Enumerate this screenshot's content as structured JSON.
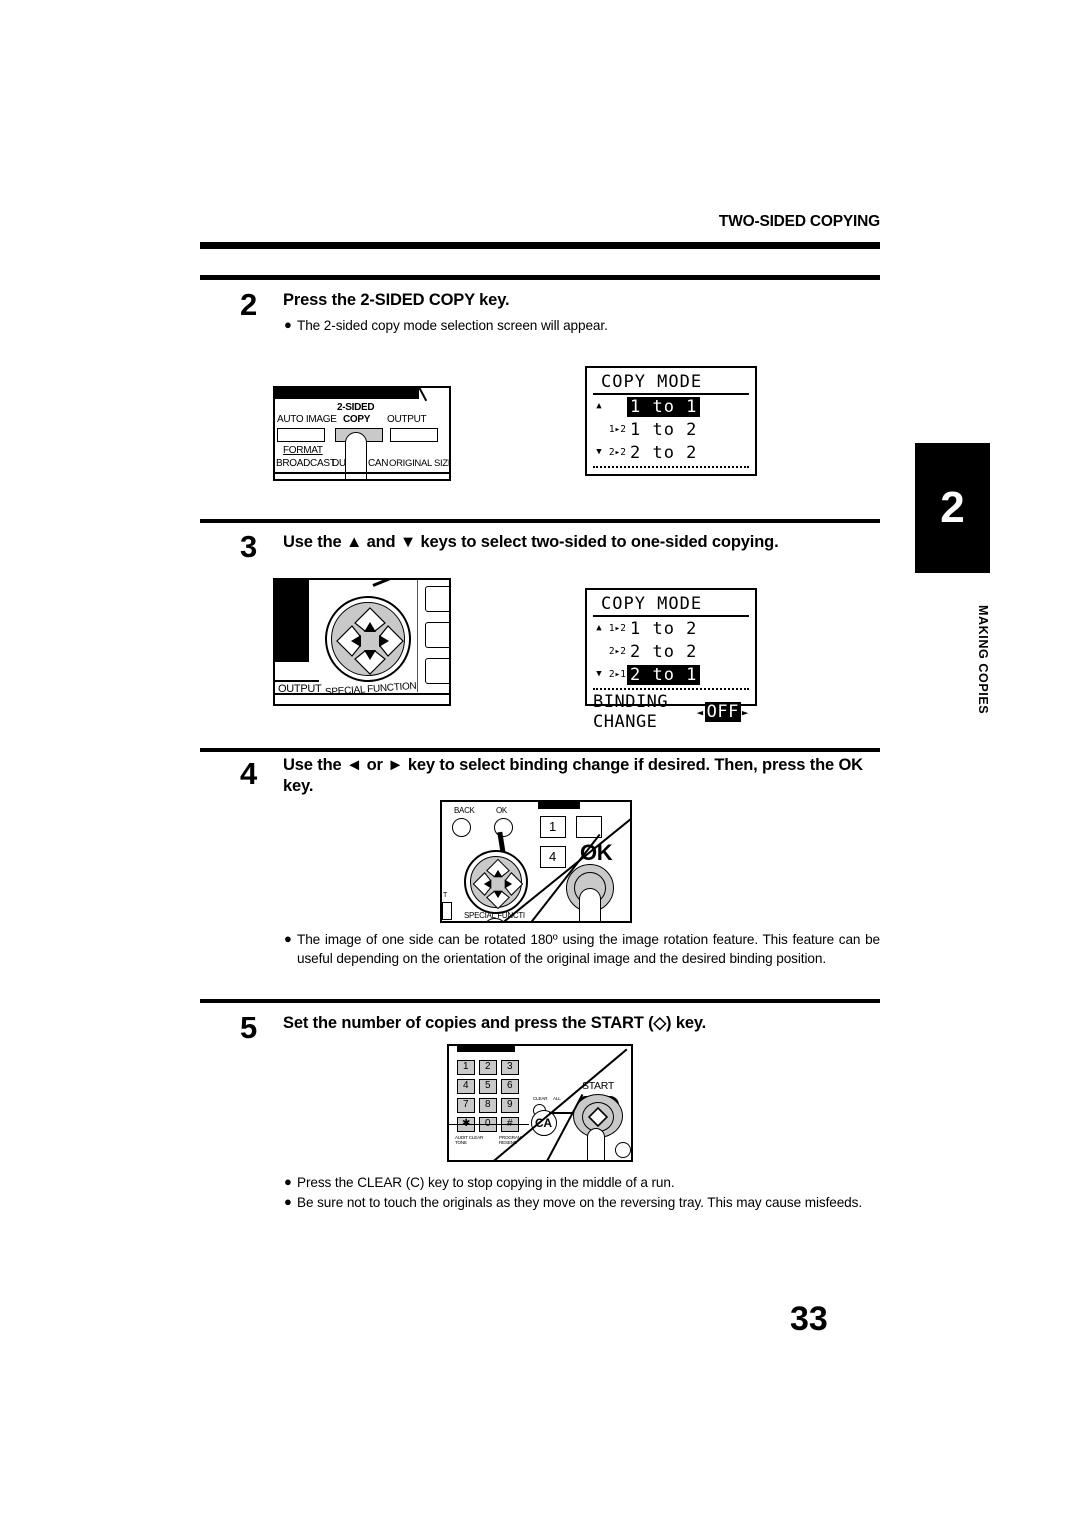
{
  "header": {
    "running_head": "TWO-SIDED COPYING"
  },
  "chapter_tab": {
    "number": "2",
    "label": "MAKING COPIES"
  },
  "folio": "33",
  "steps": [
    {
      "number": "2",
      "heading": "Press the 2-SIDED COPY key.",
      "bullets": [
        "The 2-sided copy mode selection screen will appear."
      ]
    },
    {
      "number": "3",
      "heading": "Use the ▲ and ▼ keys to select two-sided to one-sided copying.",
      "bullets": []
    },
    {
      "number": "4",
      "heading": "Use the ◄ or ► key to select binding change if desired. Then, press the OK key.",
      "bullets": [
        "The image of one side can be rotated 180º using the image rotation feature. This feature can be useful depending on the orientation of the original image and the desired binding position."
      ]
    },
    {
      "number": "5",
      "heading": "Set the number of copies and press the START (◇) key.",
      "bullets": [
        "Press the CLEAR (C) key to stop copying in the middle of a run.",
        "Be sure not to touch the originals as they move on the reversing tray. This may cause misfeeds."
      ]
    }
  ],
  "lcd_step2": {
    "title": "COPY MODE",
    "rows": [
      {
        "scroll": "▲",
        "prefix": "",
        "value": "1 to 1",
        "selected": true
      },
      {
        "scroll": "",
        "prefix": "1▸2",
        "value": "1 to 2",
        "selected": false
      },
      {
        "scroll": "▼",
        "prefix": "2▸2",
        "value": "2 to 2",
        "selected": false
      }
    ],
    "binding": null
  },
  "lcd_step3": {
    "title": "COPY MODE",
    "rows": [
      {
        "scroll": "▲",
        "prefix": "1▸2",
        "value": "1 to 2",
        "selected": false
      },
      {
        "scroll": "",
        "prefix": "2▸2",
        "value": "2 to 2",
        "selected": false
      },
      {
        "scroll": "▼",
        "prefix": "2▸1",
        "value": "2 to 1",
        "selected": true
      }
    ],
    "binding": {
      "label": "BINDING CHANGE",
      "left_arrow": "◄",
      "value": "OFF",
      "right_arrow": "►"
    }
  },
  "panel_step2": {
    "keys": [
      "AUTO IMAGE",
      "2-SIDED COPY",
      "OUTPUT"
    ],
    "labels": [
      "FORMAT",
      "BROADCAST",
      "DUPLEX",
      "SCAN",
      "ORIGINAL SIZE"
    ],
    "line1": "2-SIDED",
    "auto_image": "AUTO IMAGE",
    "copy": "COPY",
    "output": "OUTPUT",
    "format": "FORMAT",
    "broadcast": "BROADCAST",
    "dup": "DUP",
    "can": "CAN",
    "original_size": "ORIGINAL SIZE"
  },
  "panel_step3": {
    "output": "OUTPUT",
    "special_function": "SPECIAL FUNCTION"
  },
  "panel_step4": {
    "back": "BACK",
    "ok": "OK",
    "ok_big": "OK",
    "special_function": "SPECIAL FUNCTI",
    "key_1": "1",
    "key_4": "4",
    "edge_t": "T"
  },
  "panel_step5": {
    "keypad": [
      "1",
      "2",
      "3",
      "4",
      "5",
      "6",
      "7",
      "8",
      "9",
      "✱",
      "0",
      "#"
    ],
    "start_label": "START",
    "ca_label": "CA",
    "clear_label": "CLEAR",
    "clear_all_label": "ALL",
    "star_sub": "AUDIT CLEAR\nTONE",
    "hash_sub": "PROGRAM\nRESEND"
  }
}
